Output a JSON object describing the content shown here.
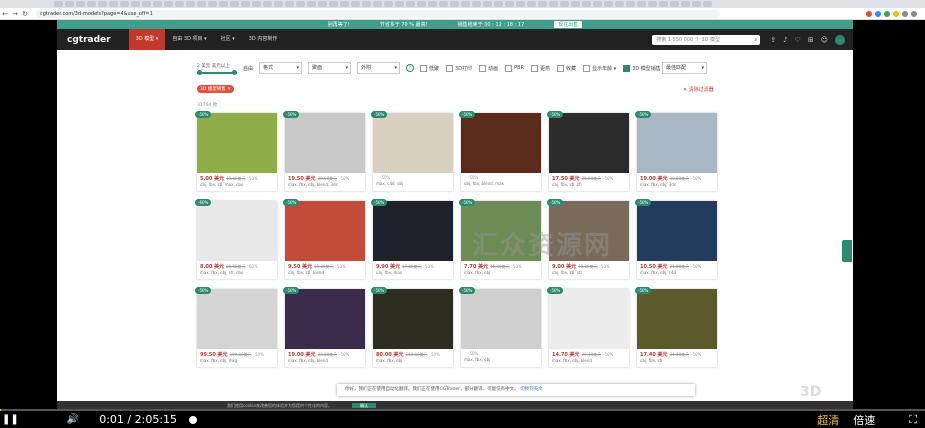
{
  "browser": {
    "url": "cgtrader.com/3d-models?page=4&use_off=1",
    "nav": [
      "←",
      "→",
      "↻"
    ]
  },
  "banner": {
    "left": "别再等了!",
    "mid": "节省多于 70 % 最高!",
    "timer": "销售结束于 00 : 12 : 18 : 17",
    "shop": "现在出售"
  },
  "header": {
    "logo": "cgtrader",
    "nav": [
      "3D 模型 ▾",
      "自由 3D 项目 ▾",
      "社区 ▾",
      "3D 内容制作"
    ],
    "search_placeholder": "搜索 1 550 000 个 3D 模型",
    "search_icon": "magnifier-icon"
  },
  "filters": {
    "price_label": "2 美元 美元以上",
    "free_label": "自由",
    "dropdowns": [
      "格式",
      "聚面",
      "外附"
    ],
    "checkboxes": [
      "低聚",
      "3D打印",
      "动画",
      "PBR",
      "更热",
      "收藏",
      "显示年龄 ▾",
      "3D 模型销售"
    ],
    "checked_index": 7,
    "sort": "最佳匹配"
  },
  "active_chip": "3D 模型销售 ✕",
  "clear_all": "✕ 清除过滤器",
  "result_count": "31764 款",
  "products": [
    {
      "pct": "-50%",
      "price": "5.00 美元",
      "old": "10.00美元",
      "off": "-50%",
      "fmt": "obj, fbx, stl, max, dae",
      "color": "#8fae4a"
    },
    {
      "pct": "-50%",
      "price": "19.50 美元",
      "old": "39.00美元",
      "off": "-50%",
      "fmt": "max, fbx, obj, blend, 3ds",
      "color": "#c8c8c8"
    },
    {
      "pct": "-50%",
      "price": "",
      "old": "",
      "off": "-50%",
      "fmt": "max, c4d, obj",
      "color": "#d9cfc0"
    },
    {
      "pct": "-50%",
      "price": "",
      "old": "",
      "off": "-50%",
      "fmt": "obj, fbx, blend, max",
      "color": "#5a2a1a"
    },
    {
      "pct": "-50%",
      "price": "17.50 美元",
      "old": "35.00美元",
      "off": "-50%",
      "fmt": "obj, fbx, stl, ztl",
      "color": "#2c2c2c"
    },
    {
      "pct": "-50%",
      "price": "19.00 美元",
      "old": "38.00美元",
      "off": "-50%",
      "fmt": "max, fbx, obj, 3ds",
      "color": "#a9b7c4"
    },
    {
      "pct": "-60%",
      "price": "8.00 美元",
      "old": "20.00美元",
      "off": "-60%",
      "fmt": "max, fbx, obj, stl, dae",
      "color": "#e8e8e8"
    },
    {
      "pct": "-50%",
      "price": "9.50 美元",
      "old": "19.00美元",
      "off": "-50%",
      "fmt": "obj, fbx, stl, blend",
      "color": "#c44a3a"
    },
    {
      "pct": "-50%",
      "price": "9.90 美元",
      "old": "19.80美元",
      "off": "-50%",
      "fmt": "obj, fbx, max",
      "color": "#1f2229"
    },
    {
      "pct": "-50%",
      "price": "7.70 美元",
      "old": "15.40美元",
      "off": "-50%",
      "fmt": "max, fbx, obj",
      "color": "#6d8b54"
    },
    {
      "pct": "-50%",
      "price": "9.00 美元",
      "old": "18.00美元",
      "off": "-50%",
      "fmt": "obj, fbx, ztl, stl",
      "color": "#7a6a5a"
    },
    {
      "pct": "-50%",
      "price": "10.50 美元",
      "old": "21.00美元",
      "off": "-50%",
      "fmt": "max, fbx, obj, c4d",
      "color": "#233b5c"
    },
    {
      "pct": "-50%",
      "price": "99.50 美元",
      "old": "199.00美元",
      "off": "-50%",
      "fmt": "max, fbx, obj, dwg",
      "color": "#d4d4d4"
    },
    {
      "pct": "-50%",
      "price": "19.00 美元",
      "old": "38.00美元",
      "off": "-50%",
      "fmt": "max, fbx, obj, blend",
      "color": "#3a2c4a"
    },
    {
      "pct": "-50%",
      "price": "80.00 美元",
      "old": "160.00美元",
      "off": "-50%",
      "fmt": "max, fbx, obj",
      "color": "#2e2e20"
    },
    {
      "pct": "-50%",
      "price": "",
      "old": "",
      "off": "-50%",
      "fmt": "max, fbx, obj",
      "color": "#cfcfcf"
    },
    {
      "pct": "-50%",
      "price": "14.70 美元",
      "old": "29.40美元",
      "off": "-50%",
      "fmt": "max, fbx, obj, blend",
      "color": "#ececec"
    },
    {
      "pct": "-50%",
      "price": "17.40 美元",
      "old": "34.80美元",
      "off": "-50%",
      "fmt": "obj, fbx, stl",
      "color": "#5a5a2a"
    }
  ],
  "popup": {
    "text": "你好，我们正在使用自动化翻译。我们正在使用CGTrader，部分翻译、可能仅有中文。",
    "link": "切换到英文"
  },
  "watermark": "汇众资源网",
  "cookie": {
    "text": "我们使用cookie来改善您的体验并为您提供个性化的内容。",
    "button": "确认"
  },
  "corner_logo": "3D",
  "player": {
    "time": "0:01 / 2:05:15",
    "quality": "超清",
    "speed": "倍速",
    "progress_fraction": 0.0001
  }
}
